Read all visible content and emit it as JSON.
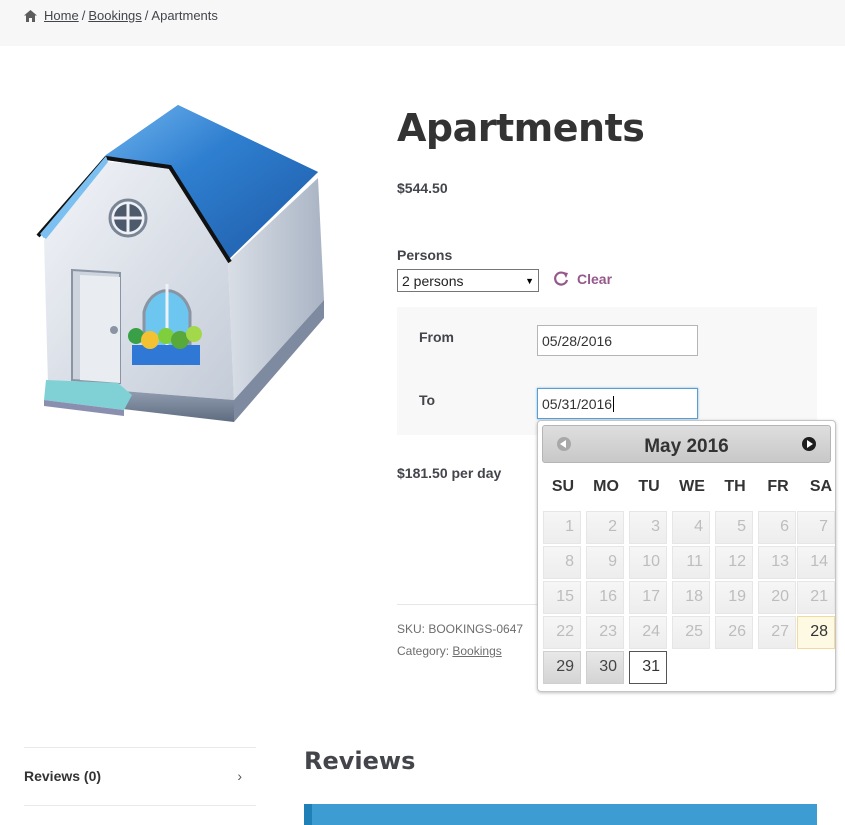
{
  "breadcrumb": {
    "home_icon": "home-icon",
    "items": [
      "Home",
      "Bookings"
    ],
    "separator": "/",
    "current": "Apartments"
  },
  "product": {
    "title": "Apartments",
    "price": "$544.50",
    "image": "house-illustration"
  },
  "booking_form": {
    "persons_label": "Persons",
    "persons_value": "2 persons",
    "clear_label": "Clear",
    "clear_icon": "refresh-icon",
    "from_label": "From",
    "from_value": "05/28/2016",
    "to_label": "To",
    "to_value": "05/31/2016",
    "per_day": "$181.50 per day"
  },
  "datepicker": {
    "title": "May 2016",
    "prev_icon": "prev-arrow-icon",
    "next_icon": "next-arrow-icon",
    "weekdays": [
      "SU",
      "MO",
      "TU",
      "WE",
      "TH",
      "FR",
      "SA"
    ],
    "weeks": [
      [
        "1",
        "2",
        "3",
        "4",
        "5",
        "6",
        "7"
      ],
      [
        "8",
        "9",
        "10",
        "11",
        "12",
        "13",
        "14"
      ],
      [
        "15",
        "16",
        "17",
        "18",
        "19",
        "20",
        "21"
      ],
      [
        "22",
        "23",
        "24",
        "25",
        "26",
        "27",
        "28"
      ],
      [
        "29",
        "30",
        "31"
      ]
    ],
    "selected_day": "28",
    "range_days": [
      "29",
      "30"
    ],
    "end_day": "31"
  },
  "meta": {
    "sku": "SKU: BOOKINGS-0647",
    "category_prefix": "Category:",
    "category_link": "Bookings"
  },
  "tabs": {
    "reviews_tab": "Reviews (0)",
    "chevron": "›"
  },
  "reviews": {
    "heading": "Reviews"
  },
  "colors": {
    "accent": "#96588a",
    "info_bar": "#3d9cd2",
    "roof_blue": "#2168b8"
  }
}
